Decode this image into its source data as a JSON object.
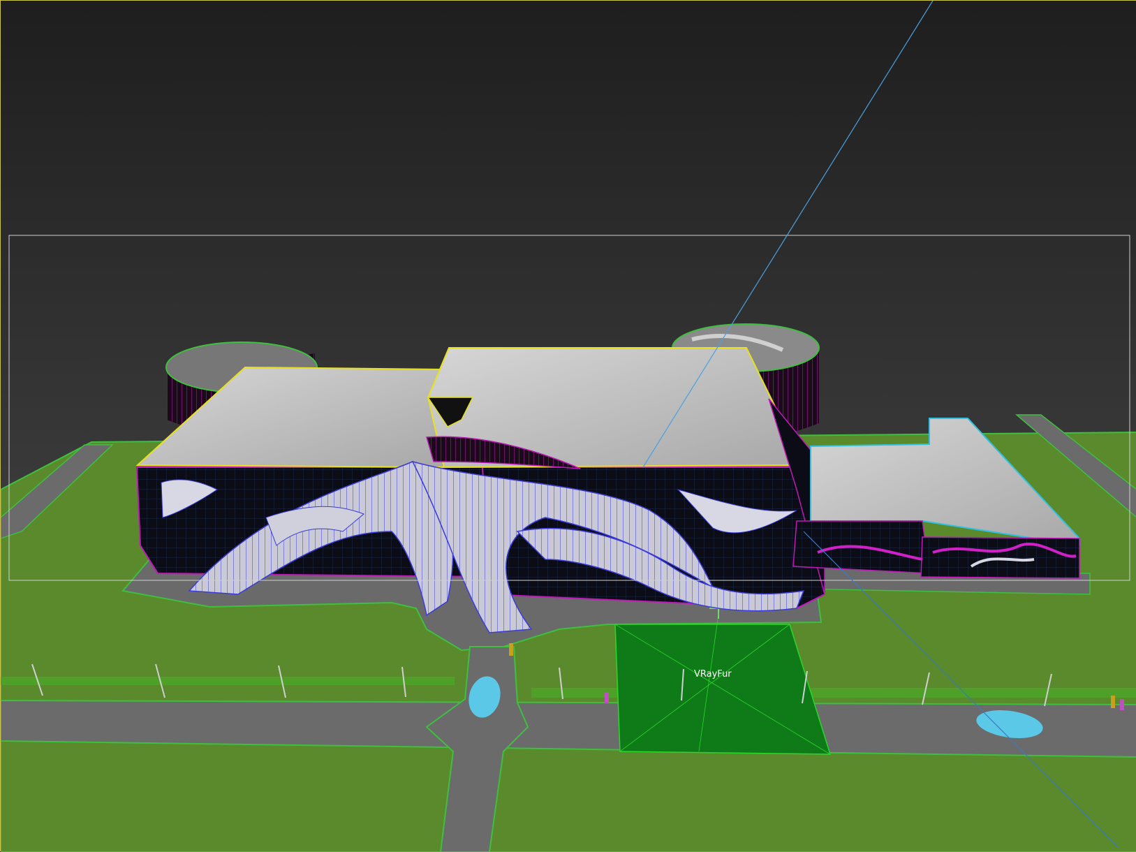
{
  "viewport": {
    "objects": [
      {
        "name": "VRayFur",
        "icon": "vrayfur-helper-icon"
      }
    ]
  },
  "colors": {
    "background": "#262626",
    "viewport_border": "#c9c34a",
    "grass": "#5a8a2c",
    "road": "#6b6b6b",
    "selection": "#e6e01f",
    "wire_magenta": "#d020c8",
    "wire_blue": "#4040e0",
    "camera_line": "#4aa0e0",
    "vrayfur": "#0f7a18",
    "car": "#5cc8e8"
  }
}
